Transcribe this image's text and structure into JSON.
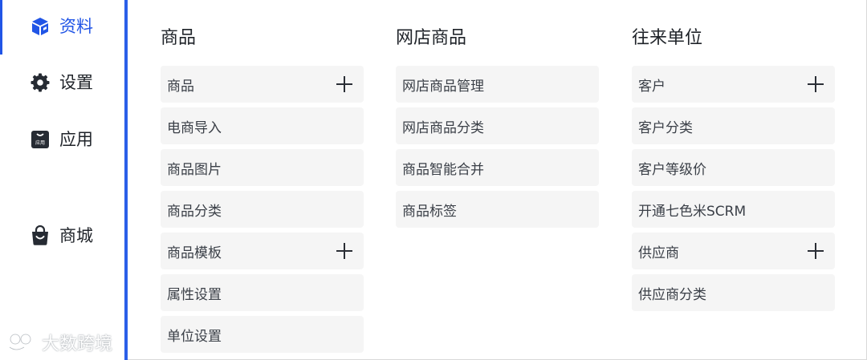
{
  "sidebar": {
    "items": [
      {
        "label": "资料",
        "icon": "cube-icon",
        "active": true
      },
      {
        "label": "设置",
        "icon": "gear-icon",
        "active": false
      },
      {
        "label": "应用",
        "icon": "app-bag-icon",
        "active": false,
        "icon_text": "应用"
      },
      {
        "label": "商城",
        "icon": "shopping-bag-icon",
        "active": false
      }
    ]
  },
  "columns": [
    {
      "title": "商品",
      "items": [
        {
          "label": "商品",
          "has_add": true
        },
        {
          "label": "电商导入",
          "has_add": false
        },
        {
          "label": "商品图片",
          "has_add": false
        },
        {
          "label": "商品分类",
          "has_add": false
        },
        {
          "label": "商品模板",
          "has_add": true
        },
        {
          "label": "属性设置",
          "has_add": false
        },
        {
          "label": "单位设置",
          "has_add": false
        }
      ]
    },
    {
      "title": "网店商品",
      "items": [
        {
          "label": "网店商品管理",
          "has_add": false
        },
        {
          "label": "网店商品分类",
          "has_add": false
        },
        {
          "label": "商品智能合并",
          "has_add": false
        },
        {
          "label": "商品标签",
          "has_add": false
        }
      ]
    },
    {
      "title": "往来单位",
      "items": [
        {
          "label": "客户",
          "has_add": true
        },
        {
          "label": "客户分类",
          "has_add": false
        },
        {
          "label": "客户等级价",
          "has_add": false
        },
        {
          "label": "开通七色米SCRM",
          "has_add": false
        },
        {
          "label": "供应商",
          "has_add": true
        },
        {
          "label": "供应商分类",
          "has_add": false
        }
      ]
    }
  ],
  "watermark": {
    "text": "大数跨境"
  },
  "colors": {
    "accent": "#2155e6",
    "card_bg": "#f5f5f5",
    "text": "#1f2329"
  }
}
